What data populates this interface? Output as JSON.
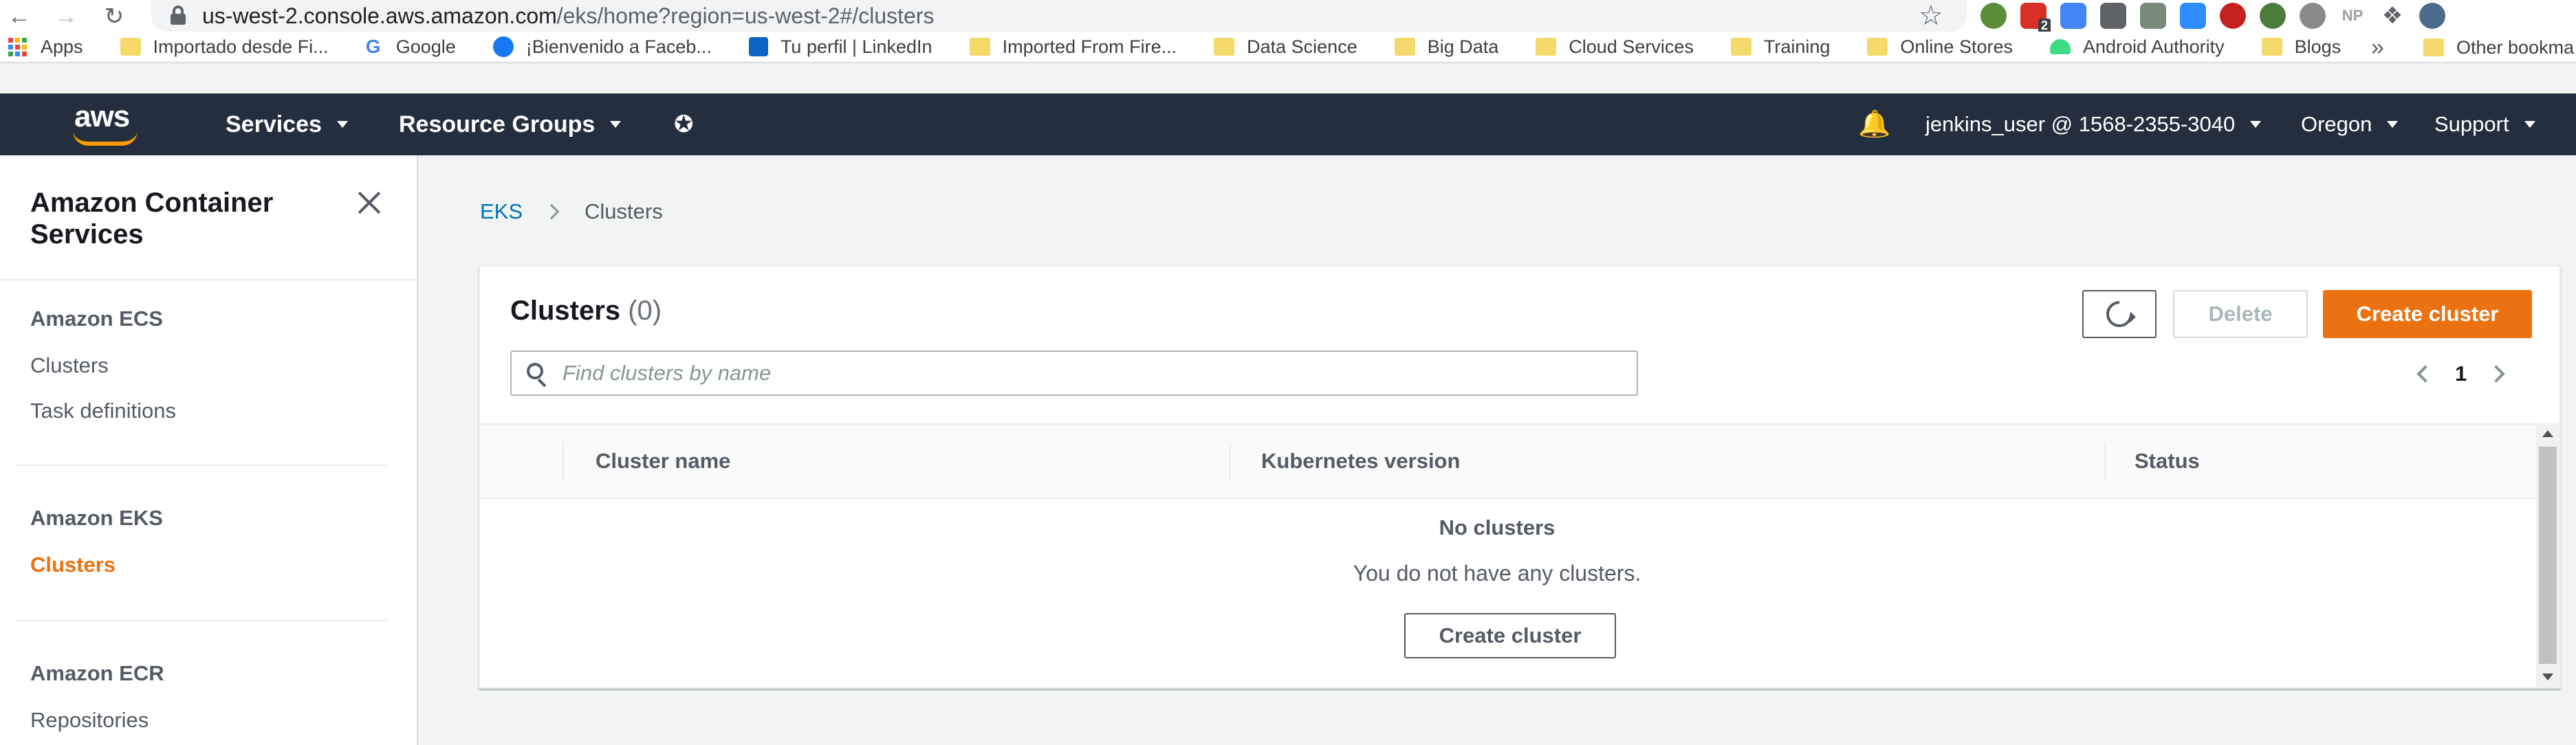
{
  "browser": {
    "url_host": "us-west-2.console.aws.amazon.com",
    "url_path": "/eks/home?region=us-west-2#/clusters",
    "bookmarks": [
      {
        "label": "Apps",
        "icon": "apps-grid-icon"
      },
      {
        "label": "Importado desde Fi...",
        "icon": "folder-icon"
      },
      {
        "label": "Google",
        "icon": "google-icon"
      },
      {
        "label": "¡Bienvenido a Faceb...",
        "icon": "facebook-icon"
      },
      {
        "label": "Tu perfil | LinkedIn",
        "icon": "linkedin-icon"
      },
      {
        "label": "Imported From Fire...",
        "icon": "folder-icon"
      },
      {
        "label": "Data Science",
        "icon": "folder-icon"
      },
      {
        "label": "Big Data",
        "icon": "folder-icon"
      },
      {
        "label": "Cloud Services",
        "icon": "folder-icon"
      },
      {
        "label": "Training",
        "icon": "folder-icon"
      },
      {
        "label": "Online Stores",
        "icon": "folder-icon"
      },
      {
        "label": "Android Authority",
        "icon": "android-icon"
      },
      {
        "label": "Blogs",
        "icon": "folder-icon"
      }
    ],
    "other_bookmarks": "Other bookma",
    "more_chevron": "»",
    "extension_badge": "2",
    "np_label": "NP"
  },
  "aws_nav": {
    "logo": "aws",
    "services": "Services",
    "resource_groups": "Resource Groups",
    "account": "jenkins_user @ 1568-2355-3040",
    "region": "Oregon",
    "support": "Support"
  },
  "sidebar": {
    "title": "Amazon Container Services",
    "sections": [
      {
        "heading": "Amazon ECS",
        "items": [
          "Clusters",
          "Task definitions"
        ]
      },
      {
        "heading": "Amazon EKS",
        "items": [
          "Clusters"
        ]
      },
      {
        "heading": "Amazon ECR",
        "items": [
          "Repositories"
        ]
      }
    ]
  },
  "breadcrumb": {
    "root": "EKS",
    "current": "Clusters"
  },
  "clusters_panel": {
    "title": "Clusters",
    "count": "(0)",
    "delete_label": "Delete",
    "create_label": "Create cluster",
    "search_placeholder": "Find clusters by name",
    "page": "1",
    "columns": [
      "Cluster name",
      "Kubernetes version",
      "Status"
    ],
    "empty_title": "No clusters",
    "empty_desc": "You do not have any clusters.",
    "empty_create_label": "Create cluster"
  },
  "colors": {
    "aws_nav_bg": "#232f3e",
    "primary_orange": "#ec7211",
    "link_blue": "#0073bb"
  }
}
